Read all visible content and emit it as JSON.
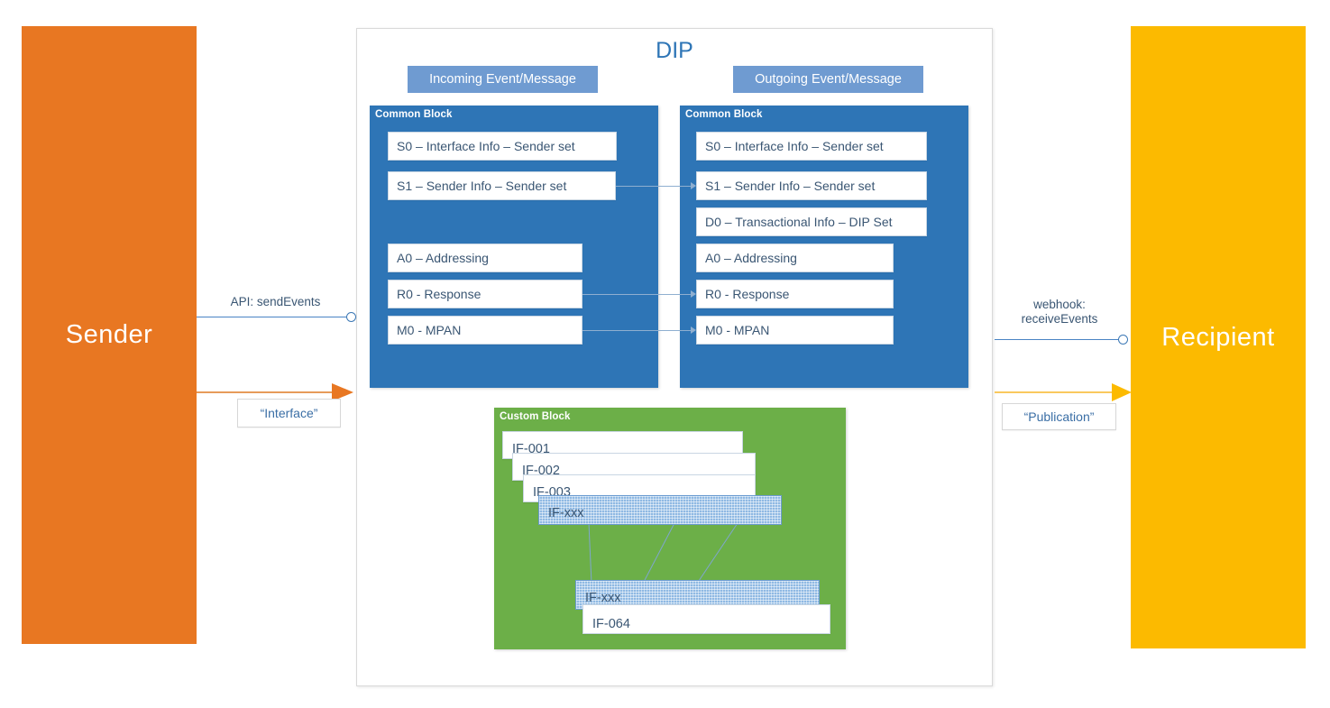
{
  "diagram": {
    "title": "DIP",
    "parties": {
      "sender": "Sender",
      "recipient": "Recipient"
    },
    "colors": {
      "sender_bg": "#E87722",
      "recipient_bg": "#FCBA00",
      "common_block_bg": "#2E75B6",
      "custom_block_bg": "#6CAF48",
      "event_pill_bg": "#6F9BD1",
      "title_color": "#2E75B6",
      "text_color": "#3A5673",
      "connector_color": "#8FAFD0",
      "hatched_box_bg": "#8FB9E3"
    },
    "pills": {
      "incoming": "Incoming Event/Message",
      "outgoing": "Outgoing Event/Message"
    },
    "common_block_caption": "Common Block",
    "custom_block_caption": "Custom Block",
    "incoming_fields": [
      {
        "id": "S0",
        "label": "S0 – Interface Info – Sender set"
      },
      {
        "id": "S1",
        "label": "S1 – Sender Info – Sender set"
      },
      {
        "id": "A0",
        "label": "A0 – Addressing"
      },
      {
        "id": "R0",
        "label": "R0 - Response"
      },
      {
        "id": "M0",
        "label": "M0 - MPAN"
      }
    ],
    "outgoing_fields": [
      {
        "id": "S0",
        "label": "S0 – Interface Info – Sender set"
      },
      {
        "id": "S1",
        "label": "S1 – Sender Info – Sender set"
      },
      {
        "id": "D0",
        "label": "D0 – Transactional Info – DIP Set"
      },
      {
        "id": "A0",
        "label": "A0 – Addressing"
      },
      {
        "id": "R0",
        "label": "R0 - Response"
      },
      {
        "id": "M0",
        "label": "M0 - MPAN"
      }
    ],
    "custom_interfaces": [
      {
        "id": "IF-001",
        "label": "IF-001",
        "style": "plain"
      },
      {
        "id": "IF-002",
        "label": "IF-002",
        "style": "plain"
      },
      {
        "id": "IF-003",
        "label": "IF-003",
        "style": "plain"
      },
      {
        "id": "IF-xxx-top",
        "label": "IF-xxx",
        "style": "hatched"
      },
      {
        "id": "IF-xxx-bottom",
        "label": "IF-xxx",
        "style": "hatched"
      },
      {
        "id": "IF-064",
        "label": "IF-064",
        "style": "plain"
      }
    ],
    "connections": {
      "api_label": "API: sendEvents",
      "webhook_label_line1": "webhook:",
      "webhook_label_line2": "receiveEvents",
      "interface_label": "“Interface”",
      "publication_label": "“Publication”"
    }
  }
}
